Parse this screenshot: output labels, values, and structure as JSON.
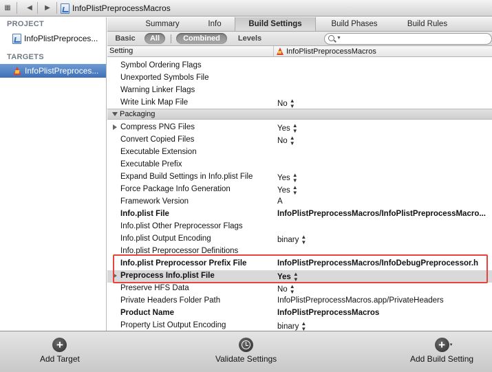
{
  "jumpbar": {
    "back_icon": "chevron-left",
    "forward_icon": "chevron-right",
    "file_name": "InfoPlistPreprocessMacros"
  },
  "sidebar": {
    "project_header": "PROJECT",
    "project_item": "InfoPlistPreproces...",
    "targets_header": "TARGETS",
    "target_item": "InfoPlistPreproces..."
  },
  "tabs": {
    "summary": "Summary",
    "info": "Info",
    "build_settings": "Build Settings",
    "build_phases": "Build Phases",
    "build_rules": "Build Rules"
  },
  "filterbar": {
    "basic": "Basic",
    "all": "All",
    "combined": "Combined",
    "levels": "Levels",
    "search_placeholder": ""
  },
  "table": {
    "col_setting": "Setting",
    "col_target": "InfoPlistPreprocessMacros",
    "rows_top": [
      {
        "name": "Symbol Ordering Flags",
        "value": ""
      },
      {
        "name": "Unexported Symbols File",
        "value": ""
      },
      {
        "name": "Warning Linker Flags",
        "value": ""
      },
      {
        "name": "Write Link Map File",
        "value": "No"
      }
    ],
    "section_packaging": "Packaging",
    "rows_packaging": [
      {
        "name": "Compress PNG Files",
        "value": "Yes"
      },
      {
        "name": "Convert Copied Files",
        "value": "No"
      },
      {
        "name": "Executable Extension",
        "value": ""
      },
      {
        "name": "Executable Prefix",
        "value": ""
      },
      {
        "name": "Expand Build Settings in Info.plist File",
        "value": "Yes"
      },
      {
        "name": "Force Package Info Generation",
        "value": "Yes"
      },
      {
        "name": "Framework Version",
        "value": "A"
      },
      {
        "name": "Info.plist File",
        "value": "InfoPlistPreprocessMacros/InfoPlistPreprocessMacro..."
      },
      {
        "name": "Info.plist Other Preprocessor Flags",
        "value": ""
      },
      {
        "name": "Info.plist Output Encoding",
        "value": "binary"
      },
      {
        "name": "Info.plist Preprocessor Definitions",
        "value": ""
      },
      {
        "name": "Info.plist Preprocessor Prefix File",
        "value": "InfoPlistPreprocessMacros/InfoDebugPreprocessor.h"
      },
      {
        "name": "Preprocess Info.plist File",
        "value": "Yes"
      },
      {
        "name": "Preserve HFS Data",
        "value": "No"
      },
      {
        "name": "Private Headers Folder Path",
        "value": "InfoPlistPreprocessMacros.app/PrivateHeaders"
      },
      {
        "name": "Product Name",
        "value": "InfoPlistPreprocessMacros"
      },
      {
        "name": "Property List Output Encoding",
        "value": "binary"
      }
    ]
  },
  "bottombar": {
    "add_target": "Add Target",
    "validate": "Validate Settings",
    "add_build_setting": "Add Build Setting"
  },
  "colors": {
    "selection": "#3e70b8",
    "highlight_box": "#e5433b"
  }
}
